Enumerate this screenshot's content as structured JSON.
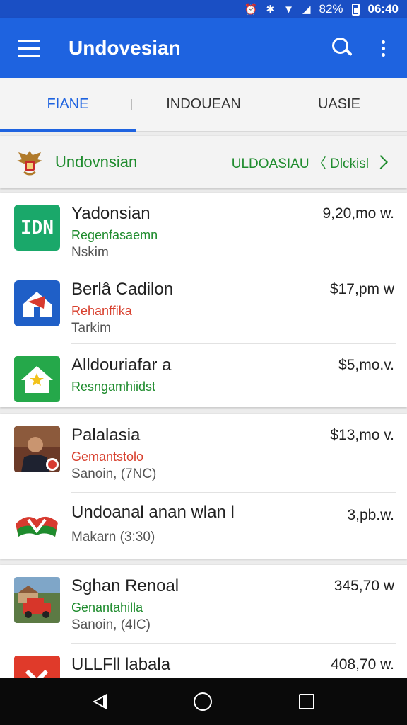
{
  "status_bar": {
    "battery": "82%",
    "time": "06:40"
  },
  "app_bar": {
    "title": "Undovesian"
  },
  "tabs": [
    {
      "label": "FIANE",
      "active": true
    },
    {
      "label": "INDOUEAN",
      "active": false
    },
    {
      "label": "UASIE",
      "active": false
    }
  ],
  "banner": {
    "name": "Undovnsian",
    "link": "ULDOASIAU 〈 Dlckisl"
  },
  "cards": [
    {
      "items": [
        {
          "title": "Yadonsian",
          "subtitle": "Regenfasaemn",
          "meta": "Nskim",
          "price": "9,20,mo w.",
          "subtitle_color": "green",
          "price_color": "dark",
          "thumb": "app-icon-teal",
          "thumb_text": "IDN"
        },
        {
          "title": "Berlâ Cadilon",
          "subtitle": "Rehanffika",
          "meta": "Tarkim",
          "price": "$17,pm w",
          "subtitle_color": "red",
          "price_color": "dark",
          "thumb": "house-icon-blue"
        },
        {
          "title": "Alldouriafar a",
          "subtitle": "Resngamhiidst",
          "meta": "",
          "price": "$5,mo.v.",
          "subtitle_color": "green",
          "price_color": "dark",
          "thumb": "house-icon-green"
        }
      ]
    },
    {
      "items": [
        {
          "title": "Palalasia",
          "subtitle": "Gemantstolo",
          "meta": "Sanoin, (7NC)",
          "price": "$13,mo v.",
          "subtitle_color": "red",
          "price_color": "green",
          "thumb": "person-photo"
        },
        {
          "title": "Undoanal anan wlan l",
          "subtitle": "",
          "meta": "Makarn (3:30)",
          "price": "3,pb.w.",
          "subtitle_color": "green",
          "price_color": "dark",
          "thumb": "flag-icon"
        }
      ]
    },
    {
      "items": [
        {
          "title": "Sghan Renoal",
          "subtitle": "Genantahilla",
          "meta": "Sanoin, (4IC)",
          "price": "345,70 w",
          "subtitle_color": "green",
          "price_color": "green",
          "thumb": "car-photo"
        },
        {
          "title": "ULLFll labala",
          "subtitle": "",
          "meta": "",
          "price": "408,70 w.",
          "subtitle_color": "green",
          "price_color": "green",
          "thumb": "red-icon"
        }
      ]
    }
  ]
}
